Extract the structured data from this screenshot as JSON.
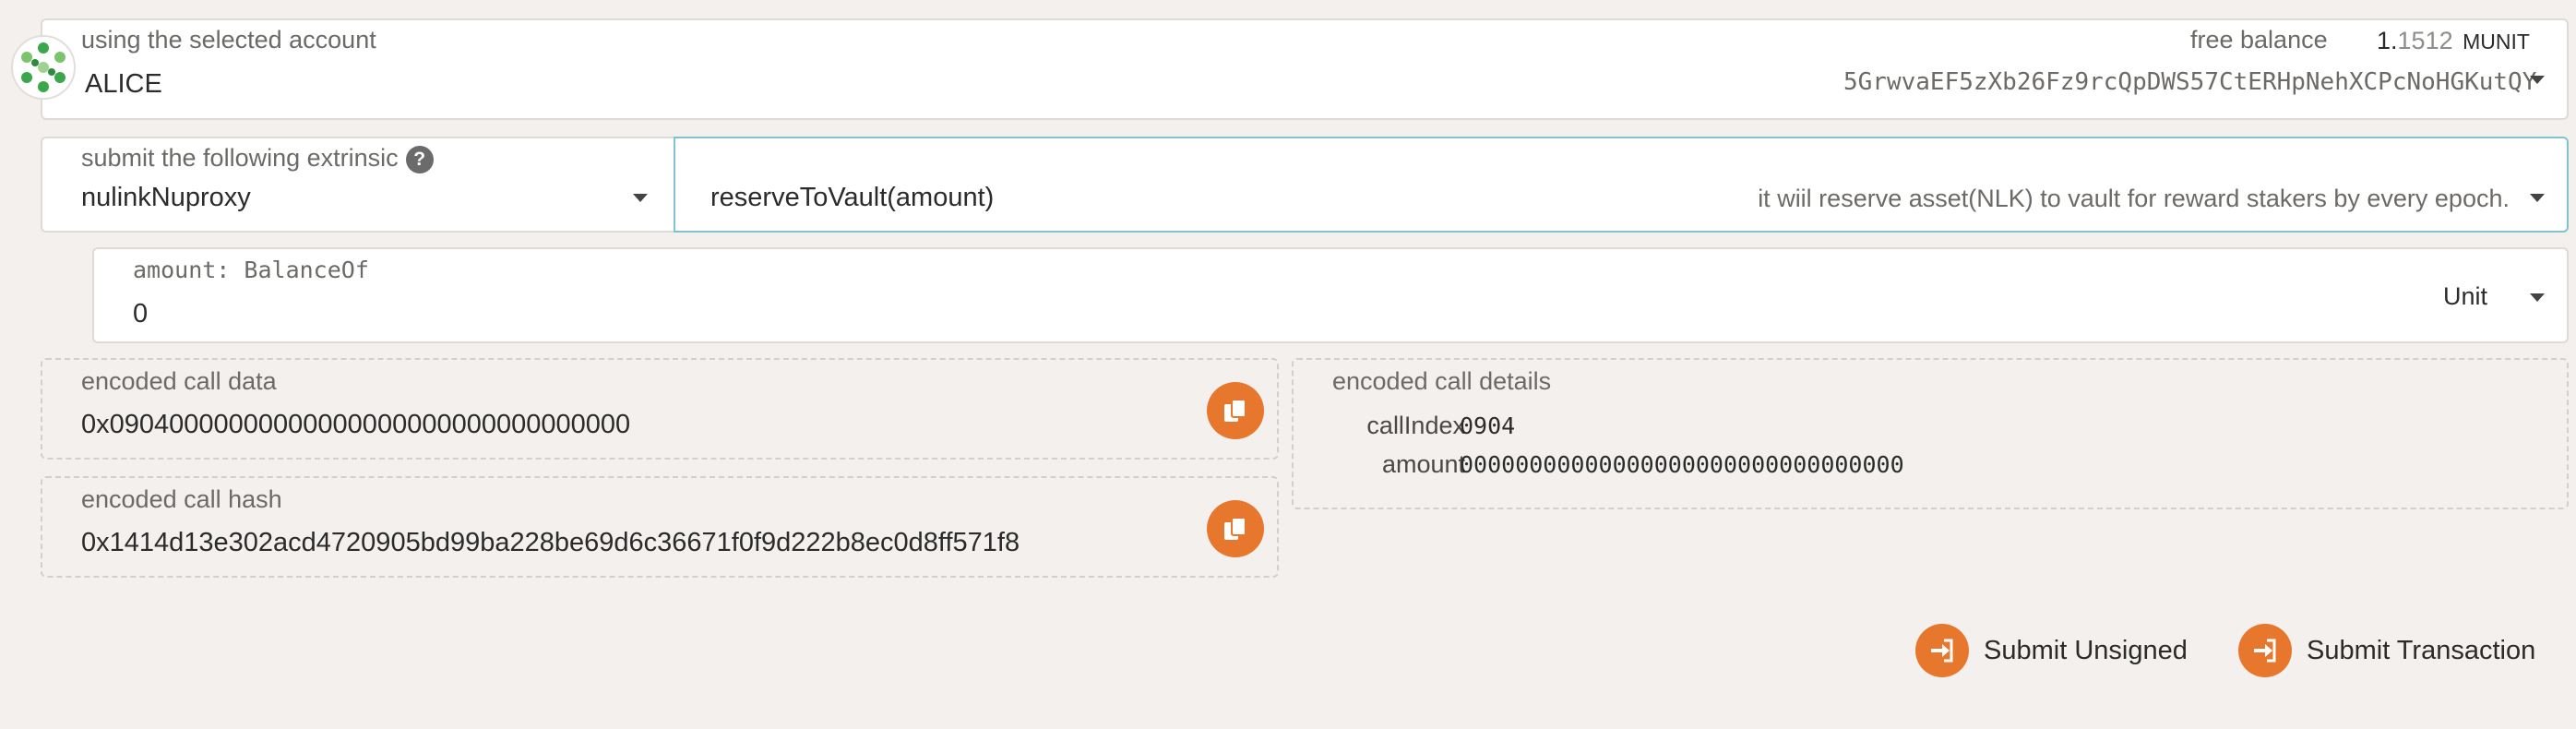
{
  "account": {
    "label": "using the selected account",
    "name": "ALICE",
    "balance_label": "free balance",
    "balance_int": "1.",
    "balance_frac": "1512",
    "balance_unit": "MUNIT",
    "address": "5GrwvaEF5zXb26Fz9rcQpDWS57CtERHpNehXCPcNoHGKutQY"
  },
  "extrinsic": {
    "label": "submit the following extrinsic",
    "help": "?",
    "pallet": "nulinkNuproxy",
    "method": "reserveToVault(amount)",
    "description": "it wiil reserve asset(NLK) to vault for reward stakers by every epoch."
  },
  "param": {
    "label": "amount: BalanceOf",
    "value": "0",
    "unit": "Unit"
  },
  "encoded": {
    "data_label": "encoded call data",
    "data_value": "0x09040000000000000000000000000000000",
    "hash_label": "encoded call hash",
    "hash_value": "0x1414d13e302acd4720905bd99ba228be69d6c36671f0f9d222b8ec0d8ff571f8",
    "details_label": "encoded call details",
    "call_index_label": "callIndex",
    "call_index_value": "0904",
    "amount_label": "amount",
    "amount_value": "00000000000000000000000000000000"
  },
  "actions": {
    "submit_unsigned": "Submit Unsigned",
    "submit_transaction": "Submit Transaction"
  },
  "colors": {
    "accent": "#e8772e",
    "background": "#f3f0ed",
    "focus_border": "#82c3d2"
  },
  "icons": {
    "avatar": "polkadot-identicon",
    "copy": "copy-icon",
    "submit": "sign-in-icon"
  }
}
